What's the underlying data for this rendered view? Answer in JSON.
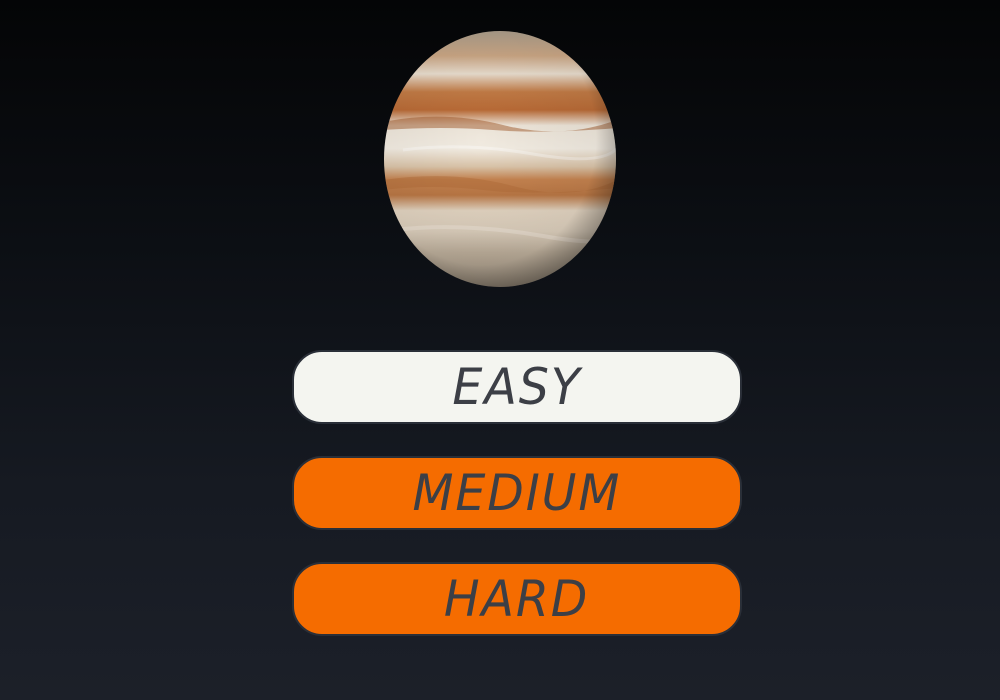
{
  "planet": {
    "icon": "jupiter-planet"
  },
  "menu": {
    "items": [
      {
        "label": "EASY",
        "state": "selected"
      },
      {
        "label": "MEDIUM",
        "state": "normal"
      },
      {
        "label": "HARD",
        "state": "normal"
      }
    ]
  },
  "colors": {
    "selected_button": "#f4f5f0",
    "button": "#f56c00",
    "button_text": "#3c3f46",
    "background_top": "#040506",
    "background_bottom": "#1c2029"
  }
}
